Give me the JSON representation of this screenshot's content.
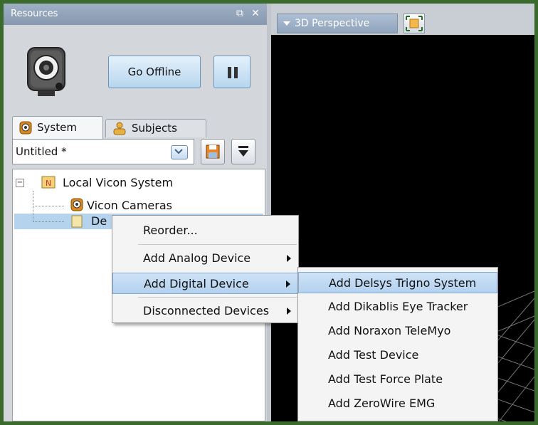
{
  "resources": {
    "title": "Resources",
    "go_offline": "Go Offline",
    "tabs": {
      "system": "System",
      "subjects": "Subjects"
    },
    "config": {
      "value": "Untitled *"
    },
    "tree": {
      "root": "Local Vicon System",
      "cameras": "Vicon Cameras",
      "devices_partial": "De"
    }
  },
  "viewport": {
    "dropdown_label": "3D Perspective"
  },
  "context_menu": {
    "items": [
      "Reorder...",
      "Add Analog Device",
      "Add Digital Device",
      "Disconnected Devices"
    ]
  },
  "submenu": {
    "items": [
      "Add Delsys Trigno System",
      "Add Dikablis Eye Tracker",
      "Add Noraxon TeleMyo",
      "Add Test Device",
      "Add Test Force Plate",
      "Add ZeroWire EMG"
    ]
  },
  "colors": {
    "highlight": "#b3d1ef",
    "frame": "#3a6a2c",
    "panel_header": "#8799b0"
  }
}
